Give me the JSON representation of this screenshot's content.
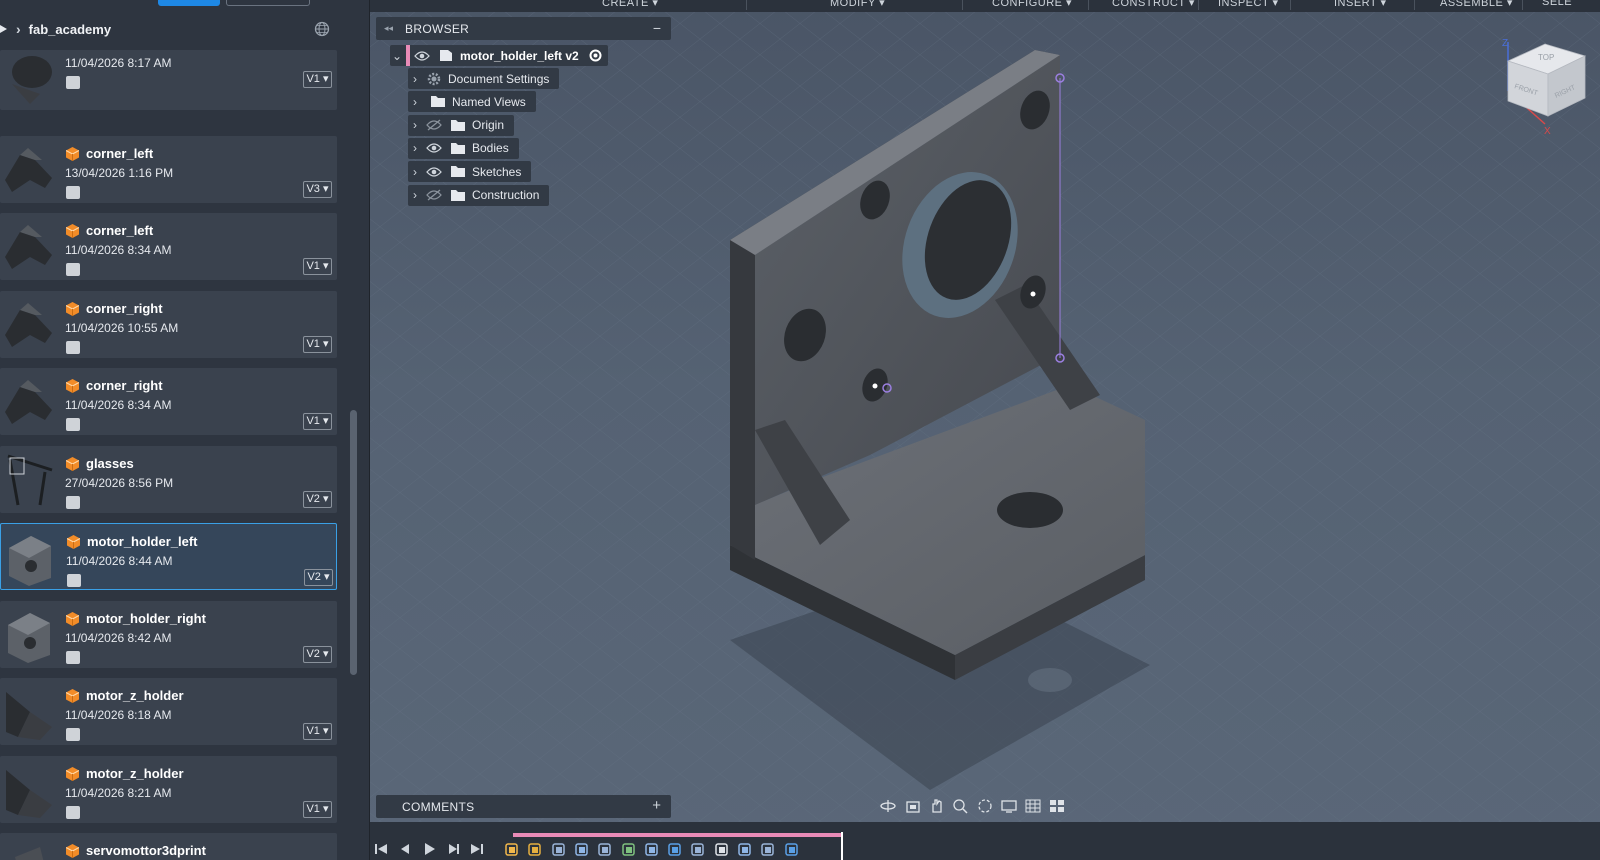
{
  "project": {
    "name": "fab_academy"
  },
  "files": [
    {
      "name": "",
      "date": "11/04/2026 8:17 AM",
      "version": "V1 ▾",
      "thumb": "part"
    },
    {
      "name": "corner_left",
      "date": "13/04/2026 1:16 PM",
      "version": "V3 ▾",
      "thumb": "corner"
    },
    {
      "name": "corner_left",
      "date": "11/04/2026 8:34 AM",
      "version": "V1 ▾",
      "thumb": "corner"
    },
    {
      "name": "corner_right",
      "date": "11/04/2026 10:55 AM",
      "version": "V1 ▾",
      "thumb": "corner"
    },
    {
      "name": "corner_right",
      "date": "11/04/2026 8:34 AM",
      "version": "V1 ▾",
      "thumb": "corner"
    },
    {
      "name": "glasses",
      "date": "27/04/2026 8:56 PM",
      "version": "V2 ▾",
      "thumb": "glasses"
    },
    {
      "name": "motor_holder_left",
      "date": "11/04/2026 8:44 AM",
      "version": "V2 ▾",
      "thumb": "bracket",
      "selected": true
    },
    {
      "name": "motor_holder_right",
      "date": "11/04/2026 8:42 AM",
      "version": "V2 ▾",
      "thumb": "bracket"
    },
    {
      "name": "motor_z_holder",
      "date": "11/04/2026 8:18 AM",
      "version": "V1 ▾",
      "thumb": "zholder"
    },
    {
      "name": "motor_z_holder",
      "date": "11/04/2026 8:21 AM",
      "version": "V1 ▾",
      "thumb": "zholder"
    },
    {
      "name": "servomottor3dprint",
      "date": "",
      "version": "",
      "thumb": "servo"
    }
  ],
  "toolbar": {
    "tabs": [
      "CREATE ▾",
      "MODIFY ▾",
      "CONFIGURE ▾",
      "CONSTRUCT ▾",
      "INSPECT ▾",
      "INSERT ▾",
      "ASSEMBLE ▾",
      "SELE"
    ]
  },
  "browser": {
    "title": "BROWSER",
    "root": "motor_holder_left v2",
    "items": [
      {
        "label": "Document Settings",
        "icon": "gear-icon",
        "eye": "none"
      },
      {
        "label": "Named Views",
        "icon": "folder-icon",
        "eye": "none"
      },
      {
        "label": "Origin",
        "icon": "folder-icon",
        "eye": "hidden"
      },
      {
        "label": "Bodies",
        "icon": "folder-icon",
        "eye": "visible"
      },
      {
        "label": "Sketches",
        "icon": "folder-icon",
        "eye": "visible"
      },
      {
        "label": "Construction",
        "icon": "folder-icon",
        "eye": "hidden"
      }
    ]
  },
  "comments": {
    "title": "COMMENTS"
  },
  "viewcube": {
    "top": "TOP",
    "front": "FRONT",
    "right": "RIGHT",
    "z": "Z",
    "x": "X"
  },
  "colors": {
    "accent": "#3aa0e6",
    "cube_orange": "#f28c28",
    "timeline": "#e98bb7",
    "sketch": "#9b7fe0"
  }
}
